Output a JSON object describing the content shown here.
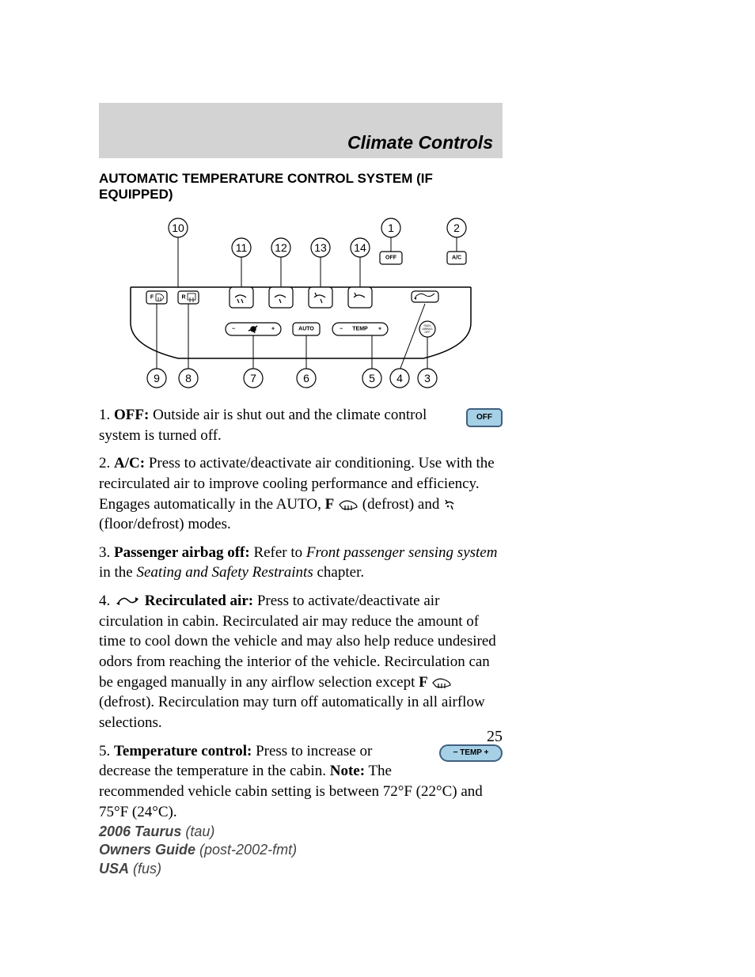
{
  "header": {
    "title": "Climate Controls"
  },
  "section_title": "AUTOMATIC TEMPERATURE CONTROL SYSTEM (IF EQUIPPED)",
  "callouts": {
    "c1": "1",
    "c2": "2",
    "c3": "3",
    "c4": "4",
    "c5": "5",
    "c6": "6",
    "c7": "7",
    "c8": "8",
    "c9": "9",
    "c10": "10",
    "c11": "11",
    "c12": "12",
    "c13": "13",
    "c14": "14"
  },
  "buttons": {
    "off": "OFF",
    "ac": "A/C",
    "f": "F",
    "r": "R",
    "auto": "AUTO",
    "temp": "TEMP",
    "minus": "−",
    "plus": "+",
    "pass_off": "PASS AIRBAG OFF",
    "fan_minus": "−",
    "fan_plus": "+"
  },
  "items": {
    "i1": {
      "num": "1.",
      "label": "OFF:",
      "text": " Outside air is shut out and the climate control system is turned off."
    },
    "i2": {
      "num": "2.",
      "label": "A/C:",
      "text_a": " Press to activate/deactivate air conditioning. Use with the recirculated air to improve cooling performance and efficiency. Engages automatically in the AUTO, ",
      "f": "F",
      "text_b": " (defrost) and ",
      "text_c": " (floor/defrost) modes."
    },
    "i3": {
      "num": "3.",
      "label": "Passenger airbag off:",
      "text_a": " Refer to ",
      "em": "Front passenger sensing system",
      "text_b": " in the ",
      "em2": "Seating and Safety Restraints",
      "text_c": " chapter."
    },
    "i4": {
      "num": "4.",
      "label": "Recirculated air:",
      "text_a": " Press to activate/deactivate air circulation in cabin. Recirculated air may reduce the amount of time to cool down the vehicle and may also help reduce undesired odors from reaching the interior of the vehicle. Recirculation can be engaged manually in any airflow selection except ",
      "f": "F",
      "text_b": " (defrost). Recirculation may turn off automatically in all airflow selections."
    },
    "i5": {
      "num": "5.",
      "label": "Temperature control:",
      "text_a": " Press to increase or decrease the temperature in the cabin. ",
      "note_label": "Note:",
      "text_b": " The recommended vehicle cabin setting is between 72°F (22°C) and 75°F (24°C)."
    }
  },
  "off_fig": "OFF",
  "temp_fig": "−   TEMP   +",
  "page_number": "25",
  "footer": {
    "l1a": "2006 Taurus",
    "l1b": " (tau)",
    "l2a": "Owners Guide",
    "l2b": " (post-2002-fmt)",
    "l3a": "USA",
    "l3b": " (fus)"
  }
}
